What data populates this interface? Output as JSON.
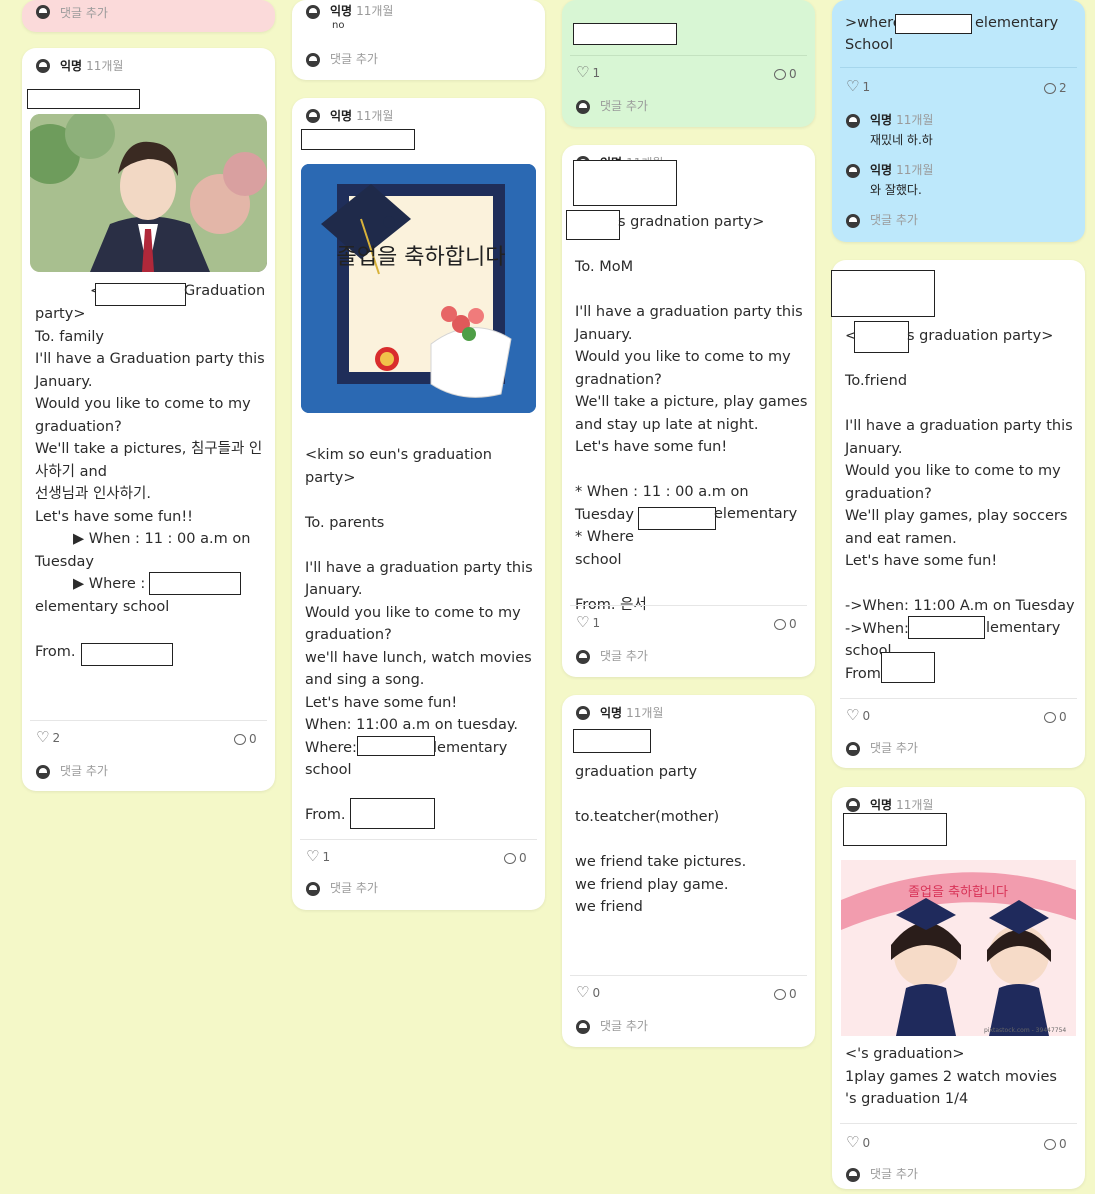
{
  "author": "익명",
  "time": "11개월",
  "add_comment": "댓글 추가",
  "col1": {
    "top_add_comment": "댓글 추가",
    "card": {
      "lines": [
        "party>",
        "To. family",
        "I'll have a Graduation party this",
        "January.",
        "Would you like to come to my",
        "graduation?",
        "We'll take a pictures, 침구들과 인",
        "사하기 and",
        "선생님과 인사하기.",
        "Let's have some fun!!",
        "▶ When :  11 : 00 a.m on",
        "Tuesday",
        "▶ Where :",
        "elementary school",
        "",
        "From. S"
      ],
      "title_tail": "Graduation",
      "title_head": "<",
      "likes": "2",
      "comments": "0"
    }
  },
  "col2": {
    "top_card": {
      "name": "익명",
      "time": "11개월",
      "text": "no"
    },
    "card": {
      "lines": [
        "<kim so eun's graduation",
        "party>",
        "",
        "To. parents",
        "",
        "I'll have a graduation party this",
        "January.",
        "Would you like to come to my",
        "graduation?",
        "we'll have lunch, watch movies",
        "and sing a song.",
        "Let's have some fun!",
        "When: 11:00 a.m on tuesday.",
        "Where:",
        "school",
        "",
        "From."
      ],
      "where_tail": "lementary",
      "image_text": "졸업을 축하합니다",
      "likes": "1",
      "comments": "0"
    }
  },
  "col3": {
    "top_card": {
      "likes": "1",
      "comments": "0"
    },
    "card1": {
      "title": "s gradnation party>",
      "lines": [
        "To. MoM",
        "",
        "I'll have a graduation party this",
        "January.",
        "Would you like to come to my",
        "gradnation?",
        "We'll take a picture, play games",
        "and stay up late at night.",
        "Let's have some fun!",
        "",
        "* When : 11 : 00 a.m on Tuesday",
        "* Where",
        "school",
        "",
        "From. 은서"
      ],
      "where_tail": "elementary",
      "likes": "1",
      "comments": "0"
    },
    "card2": {
      "lines": [
        "graduation party",
        "",
        "to.teatcher(mother)",
        "",
        "we friend take pictures.",
        "we friend play game.",
        "we friend"
      ],
      "likes": "0",
      "comments": "0"
    }
  },
  "col4": {
    "top_card": {
      "line1_head": ">where",
      "line1_tail": "elementary",
      "line2": "School",
      "likes": "1",
      "comments": "2",
      "replies": [
        {
          "name": "익명",
          "time": "11개월",
          "text": "재밌네 하.하"
        },
        {
          "name": "익명",
          "time": "11개월",
          "text": "와 잘했다."
        }
      ]
    },
    "card1": {
      "title_head": "<",
      "title": "s graduation party>",
      "lines": [
        "To.friend",
        "",
        "I'll have a graduation party this",
        "January.",
        "Would you like to come to my",
        "graduation?",
        "We'll play games, play soccers",
        "and eat ramen.",
        "Let's have some fun!",
        "",
        "->When: 11:00 A.m on Tuesday",
        "->When:",
        "school",
        "From"
      ],
      "when2_tail": "lementary",
      "likes": "0",
      "comments": "0"
    },
    "card2": {
      "image_text": "졸업을 축하합니다",
      "image_credit": "pixtastock.com - 39447754",
      "lines": [
        "<'s graduation>",
        "1play games 2 watch movies",
        "'s graduation 1/4"
      ],
      "likes": "0",
      "comments": "0"
    }
  }
}
